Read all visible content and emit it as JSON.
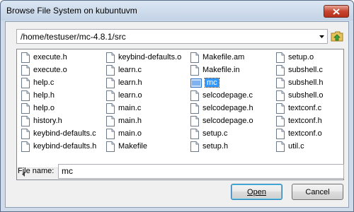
{
  "window": {
    "title": "Browse File System on kubuntuvm"
  },
  "path_combo": {
    "value": "/home/testuser/mc-4.8.1/src"
  },
  "file_list": {
    "columns": [
      [
        "execute.h",
        "execute.o",
        "help.c",
        "help.h",
        "help.o",
        "history.h",
        "keybind-defaults.c",
        "keybind-defaults.h"
      ],
      [
        "keybind-defaults.o",
        "learn.c",
        "learn.h",
        "learn.o",
        "main.c",
        "main.h",
        "main.o",
        "Makefile"
      ],
      [
        "Makefile.am",
        "Makefile.in",
        "mc",
        "selcodepage.c",
        "selcodepage.h",
        "selcodepage.o",
        "setup.c",
        "setup.h"
      ],
      [
        "setup.o",
        "subshell.c",
        "subshell.h",
        "subshell.o",
        "textconf.c",
        "textconf.h",
        "textconf.o",
        "util.c"
      ]
    ],
    "selected": "mc"
  },
  "filename": {
    "label": "File name:",
    "value": "mc"
  },
  "buttons": {
    "open": "Open",
    "cancel": "Cancel"
  },
  "icons": {
    "close": "close-icon",
    "dropdown": "chevron-down-icon",
    "up_folder": "folder-up-icon",
    "file": "file-icon",
    "folder": "folder-icon"
  },
  "colors": {
    "selection": "#3399ff",
    "titlebar": "#c3d3e6"
  }
}
